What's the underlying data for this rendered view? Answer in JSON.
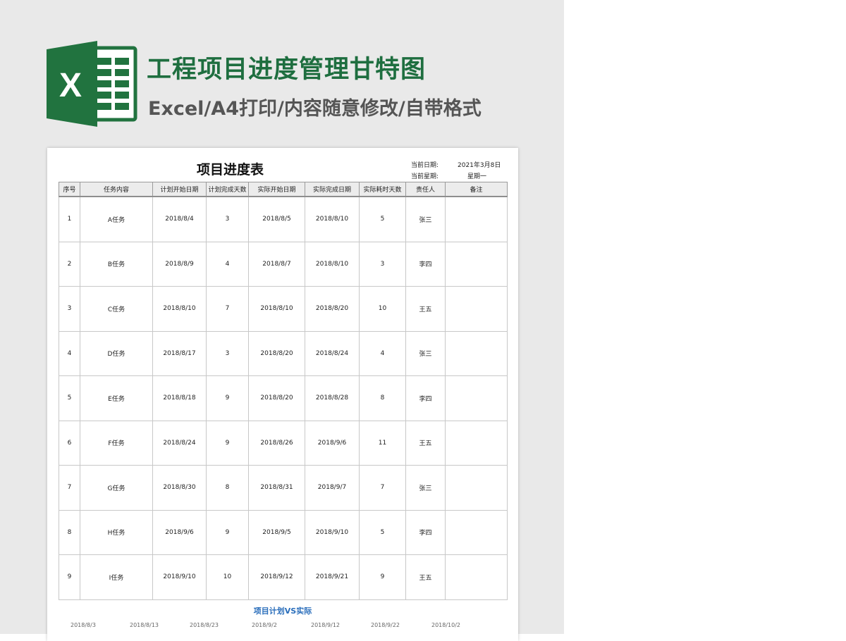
{
  "banner": {
    "title": "工程项目进度管理甘特图",
    "subtitle": "Excel/A4打印/内容随意修改/自带格式",
    "logo_letter": "X",
    "logo_icon": "excel-logo-icon",
    "title_color": "#1e6e3f",
    "logo_color": "#21733f"
  },
  "sheet": {
    "title": "项目进度表",
    "current_date_label": "当前日期:",
    "current_date_value": "2021年3月8日",
    "current_weekday_label": "当前星期:",
    "current_weekday_value": "星期一",
    "columns": [
      "序号",
      "任务内容",
      "计划开始日期",
      "计划完成天数",
      "实际开始日期",
      "实际完成日期",
      "实际耗时天数",
      "责任人",
      "备注"
    ],
    "rows": [
      [
        "1",
        "A任务",
        "2018/8/4",
        "3",
        "2018/8/5",
        "2018/8/10",
        "5",
        "张三",
        ""
      ],
      [
        "2",
        "B任务",
        "2018/8/9",
        "4",
        "2018/8/7",
        "2018/8/10",
        "3",
        "李四",
        ""
      ],
      [
        "3",
        "C任务",
        "2018/8/10",
        "7",
        "2018/8/10",
        "2018/8/20",
        "10",
        "王五",
        ""
      ],
      [
        "4",
        "D任务",
        "2018/8/17",
        "3",
        "2018/8/20",
        "2018/8/24",
        "4",
        "张三",
        ""
      ],
      [
        "5",
        "E任务",
        "2018/8/18",
        "9",
        "2018/8/20",
        "2018/8/28",
        "8",
        "李四",
        ""
      ],
      [
        "6",
        "F任务",
        "2018/8/24",
        "9",
        "2018/8/26",
        "2018/9/6",
        "11",
        "王五",
        ""
      ],
      [
        "7",
        "G任务",
        "2018/8/30",
        "8",
        "2018/8/31",
        "2018/9/7",
        "7",
        "张三",
        ""
      ],
      [
        "8",
        "H任务",
        "2018/9/6",
        "9",
        "2018/9/5",
        "2018/9/10",
        "5",
        "李四",
        ""
      ],
      [
        "9",
        "I任务",
        "2018/9/10",
        "10",
        "2018/9/12",
        "2018/9/21",
        "9",
        "王五",
        ""
      ]
    ]
  },
  "chart": {
    "title": "项目计划VS实际",
    "title_color": "#2a6ebb",
    "ticks": [
      "2018/8/3",
      "2018/8/13",
      "2018/8/23",
      "2018/9/2",
      "2018/9/12",
      "2018/9/22",
      "2018/10/2"
    ]
  }
}
